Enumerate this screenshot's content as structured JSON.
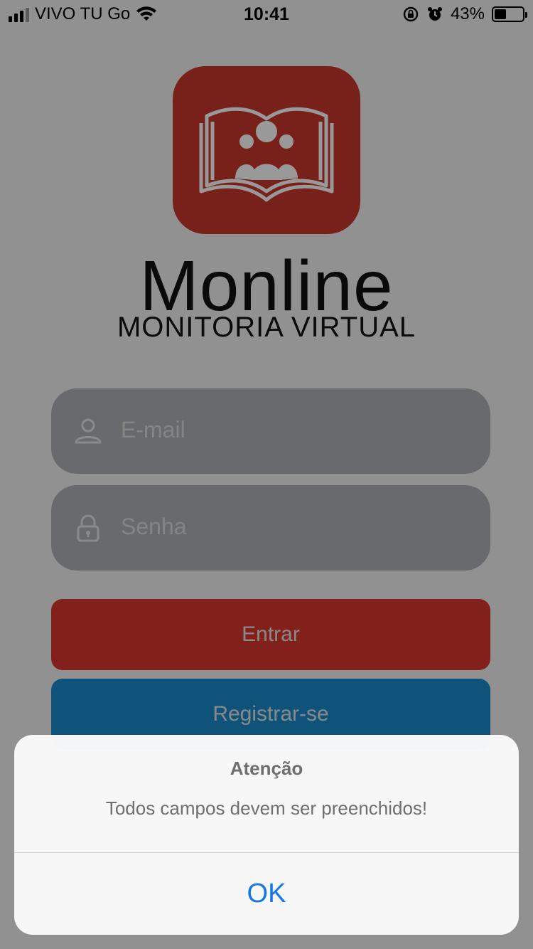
{
  "status_bar": {
    "carrier": "VIVO TU Go",
    "time": "10:41",
    "battery_percent": "43%",
    "battery_level": 0.43,
    "icons": [
      "signal-icon",
      "wifi-icon",
      "rotation-lock-icon",
      "alarm-icon",
      "battery-icon"
    ]
  },
  "brand": {
    "title": "Monline",
    "subtitle": "MONITORIA VIRTUAL",
    "logo_color": "#c9372c"
  },
  "form": {
    "email_placeholder": "E-mail",
    "password_placeholder": "Senha",
    "email_icon": "user-icon",
    "password_icon": "lock-icon"
  },
  "buttons": {
    "login_label": "Entrar",
    "register_label": "Registrar-se",
    "login_color": "#d9362d",
    "register_color": "#1a8acb"
  },
  "alert": {
    "title": "Atenção",
    "message": "Todos campos devem ser preenchidos!",
    "ok_label": "OK",
    "ok_color": "#1677e8"
  }
}
